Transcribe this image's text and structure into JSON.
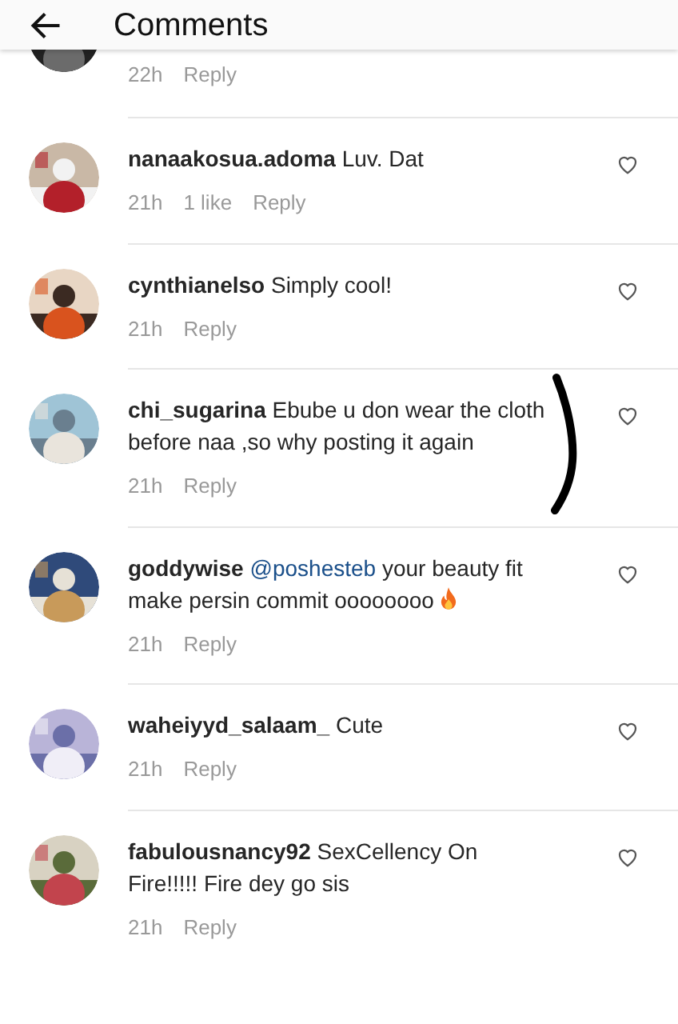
{
  "header": {
    "title": "Comments"
  },
  "partial_comment": {
    "time": "22h",
    "reply": "Reply"
  },
  "comments": [
    {
      "username": "nanaakosua.adoma",
      "text": "Luv. Dat",
      "time": "21h",
      "likes": "1 like",
      "reply": "Reply",
      "liked": false
    },
    {
      "username": "cynthianelso",
      "text": "Simply cool!",
      "time": "21h",
      "reply": "Reply",
      "liked": false
    },
    {
      "username": "chi_sugarina",
      "text": "Ebube u don wear the cloth before naa ,so why posting it again",
      "time": "21h",
      "reply": "Reply",
      "liked": false,
      "annotated": true
    },
    {
      "username": "goddywise",
      "mention": "@poshesteb",
      "text": "your beauty fit make persin commit oooooooo",
      "kind": "with_emoji",
      "time": "21h",
      "reply": "Reply",
      "liked": false
    },
    {
      "username": "waheiyyd_salaam_",
      "text": "Cute",
      "time": "21h",
      "reply": "Reply",
      "liked": false
    },
    {
      "username": "fabulousnancy92",
      "text": "SexCellency On Fire!!!!! Fire dey go sis",
      "time": "21h",
      "reply": "Reply",
      "liked": false
    }
  ]
}
